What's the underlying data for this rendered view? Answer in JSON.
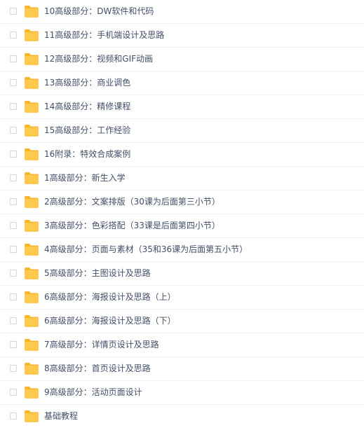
{
  "file_list": {
    "items": [
      {
        "name": "10高级部分：DW软件和代码",
        "icon": "folder-icon"
      },
      {
        "name": "11高级部分：手机端设计及思路",
        "icon": "folder-icon"
      },
      {
        "name": "12高级部分：视频和GIF动画",
        "icon": "folder-icon"
      },
      {
        "name": "13高级部分：商业调色",
        "icon": "folder-icon"
      },
      {
        "name": "14高级部分：精修课程",
        "icon": "folder-icon"
      },
      {
        "name": "15高级部分：工作经验",
        "icon": "folder-icon"
      },
      {
        "name": "16附录：特效合成案例",
        "icon": "folder-icon"
      },
      {
        "name": "1高级部分：新生入学",
        "icon": "folder-icon"
      },
      {
        "name": "2高级部分：文案排版（30课为后面第三小节）",
        "icon": "folder-icon"
      },
      {
        "name": "3高级部分：色彩搭配（33课是后面第四小节）",
        "icon": "folder-icon"
      },
      {
        "name": "4高级部分：页面与素材（35和36课为后面第五小节）",
        "icon": "folder-icon"
      },
      {
        "name": "5高级部分：主图设计及思路",
        "icon": "folder-icon"
      },
      {
        "name": "6高级部分：海报设计及思路（上）",
        "icon": "folder-icon"
      },
      {
        "name": "6高级部分：海报设计及思路（下）",
        "icon": "folder-icon"
      },
      {
        "name": "7高级部分：详情页设计及思路",
        "icon": "folder-icon"
      },
      {
        "name": "8高级部分：首页设计及思路",
        "icon": "folder-icon"
      },
      {
        "name": "9高级部分：活动页面设计",
        "icon": "folder-icon"
      },
      {
        "name": "基础教程",
        "icon": "folder-icon"
      }
    ]
  },
  "colors": {
    "folder": "#ffc94d",
    "folder_tab": "#f7b529",
    "text": "#424e67",
    "divider": "#f1f2f4",
    "checkbox_border": "#d3d6dc"
  }
}
